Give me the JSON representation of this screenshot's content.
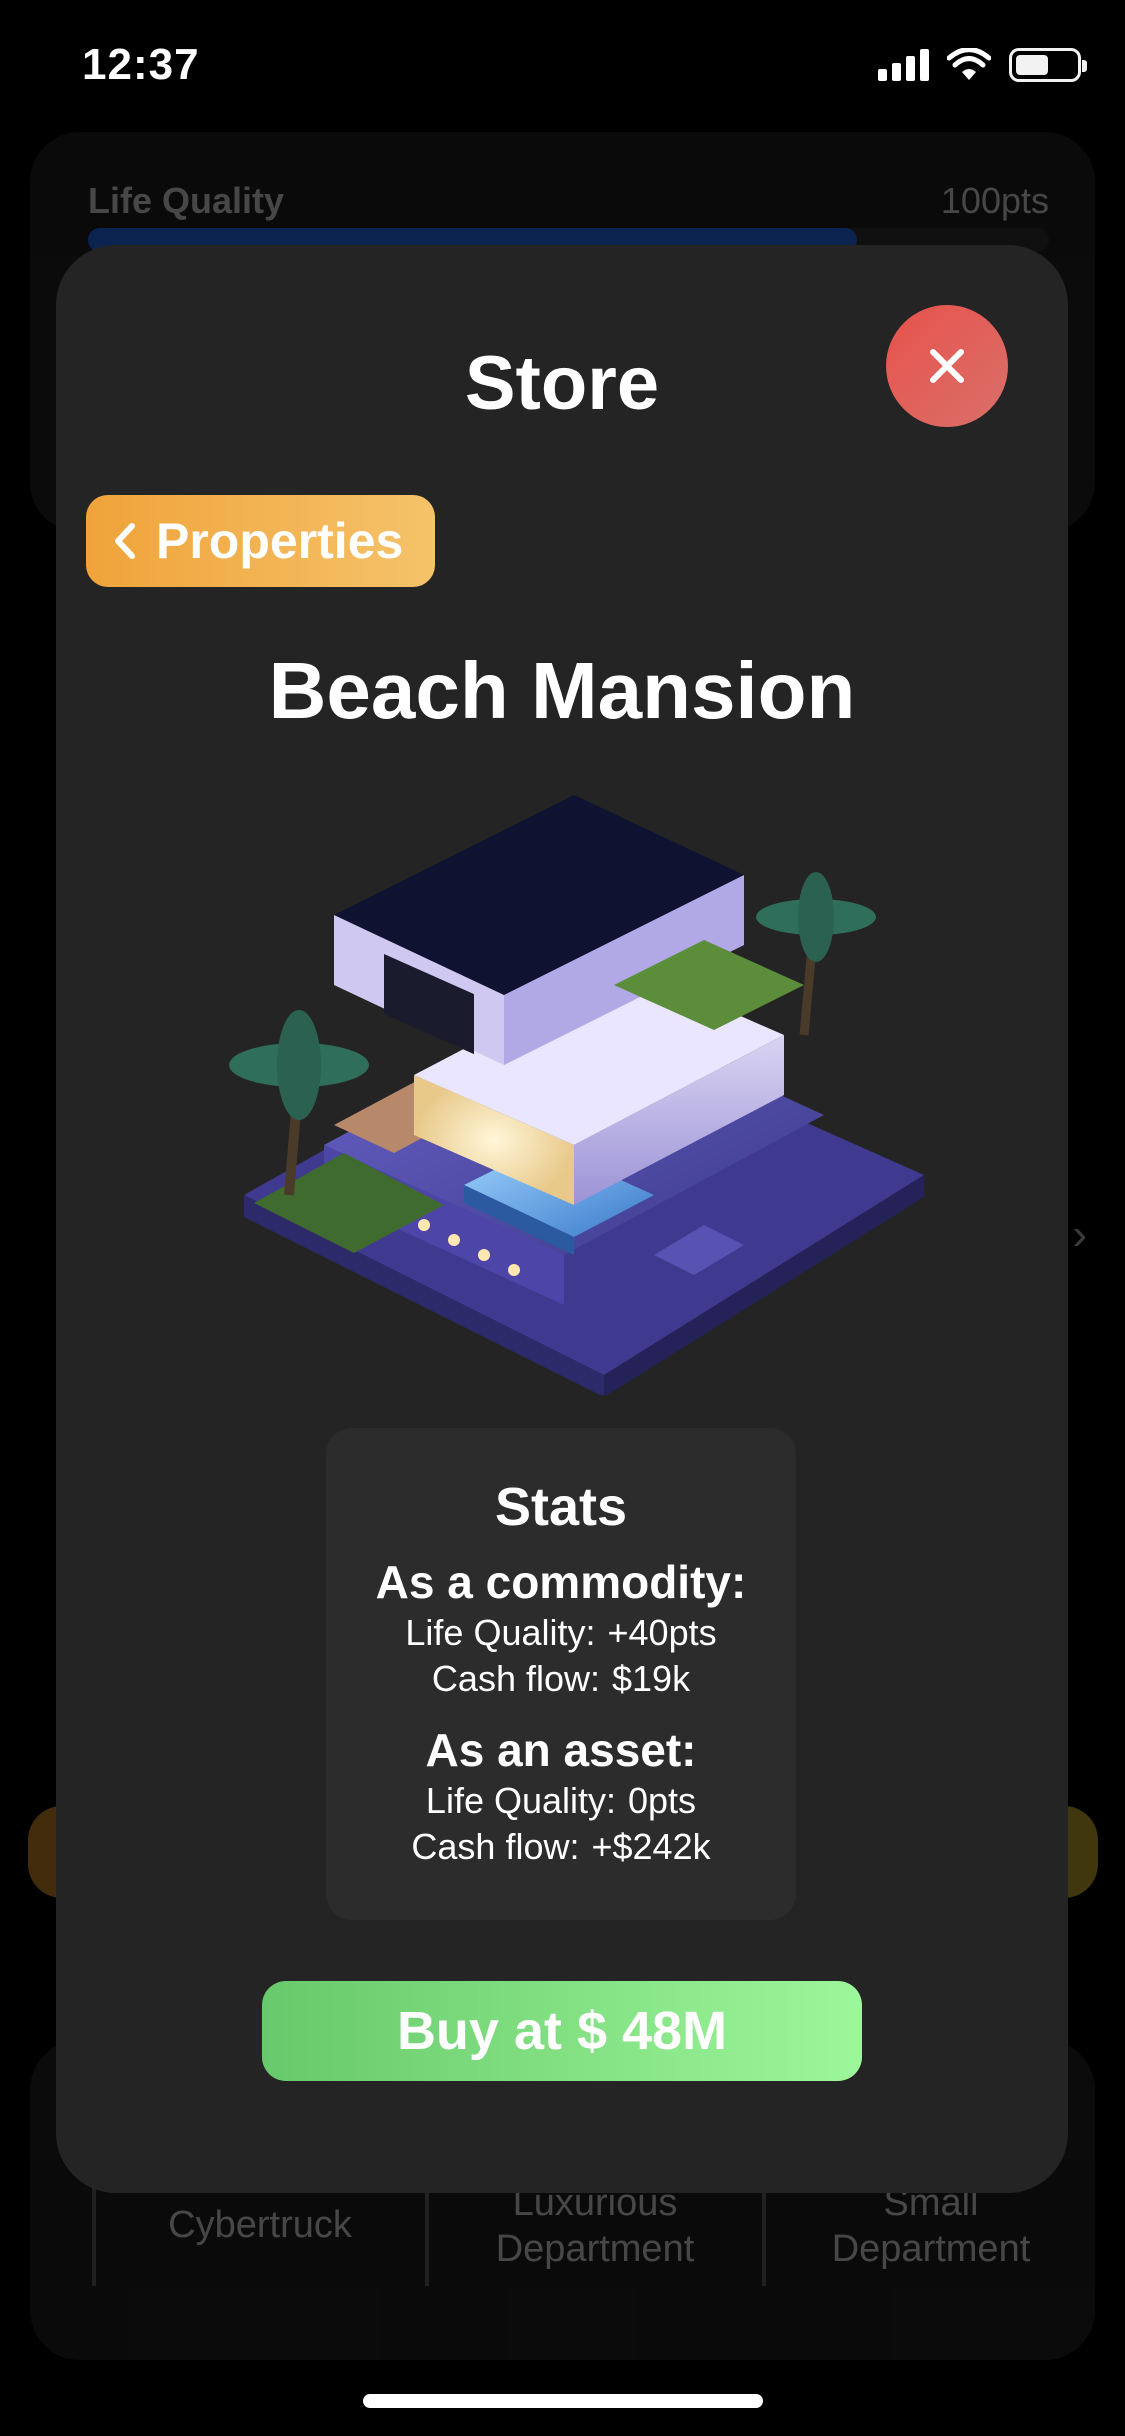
{
  "status_bar": {
    "time": "12:37"
  },
  "background": {
    "life_quality_label": "Life Quality",
    "life_quality_value": "100pts",
    "life_quality_progress": 0.8,
    "items": [
      "Cybertruck",
      "Luxurious\nDepartment",
      "Small\nDepartment"
    ]
  },
  "modal": {
    "title": "Store",
    "back_label": "Properties",
    "item_name": "Beach Mansion",
    "image_alt": "beach-mansion-illustration",
    "stats": {
      "title": "Stats",
      "commodity_heading": "As a commodity:",
      "commodity_life_quality_label": "Life Quality:",
      "commodity_life_quality_value": "+40pts",
      "commodity_cash_flow_label": "Cash flow:",
      "commodity_cash_flow_value": "$19k",
      "asset_heading": "As an asset:",
      "asset_life_quality_label": "Life Quality:",
      "asset_life_quality_value": "0pts",
      "asset_cash_flow_label": "Cash flow:",
      "asset_cash_flow_value": "+$242k"
    },
    "buy_label": "Buy at $ 48M"
  },
  "colors": {
    "accent_orange": "#f0a33a",
    "close_red": "#e8524b",
    "buy_green": "#67c96b",
    "modal_bg": "#242424"
  }
}
